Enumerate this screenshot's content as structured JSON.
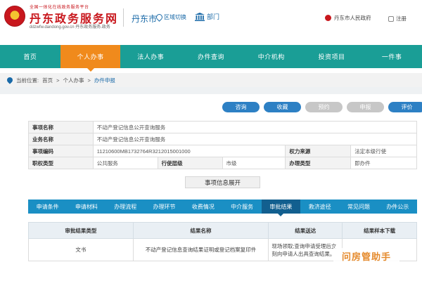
{
  "header": {
    "logo_subtitle": "全国一体化在线政务服务平台",
    "logo_title": "丹东政务服务网",
    "logo_domain": "ddzwfw.dandong.gov.cn 丹东政务服务.政务",
    "city": "丹东市",
    "region_switch": "区域切换",
    "department": "部门",
    "gov_link": "丹东市人民政府",
    "login": "注册"
  },
  "nav": {
    "items": [
      {
        "label": "首页",
        "active": false
      },
      {
        "label": "个人办事",
        "active": true
      },
      {
        "label": "法人办事",
        "active": false
      },
      {
        "label": "办件查询",
        "active": false
      },
      {
        "label": "中介机构",
        "active": false
      },
      {
        "label": "投资项目",
        "active": false
      },
      {
        "label": "一件事",
        "active": false
      }
    ]
  },
  "breadcrumb": {
    "prefix": "当前位置:",
    "items": [
      "首页",
      "个人办事",
      "办件申报"
    ],
    "separator": ">"
  },
  "actions": [
    {
      "label": "咨询",
      "enabled": true
    },
    {
      "label": "收藏",
      "enabled": true
    },
    {
      "label": "预约",
      "enabled": false
    },
    {
      "label": "申报",
      "enabled": false
    },
    {
      "label": "评价",
      "enabled": true
    }
  ],
  "info": {
    "item_name_label": "事项名称",
    "item_name_value": "不动产登记信息公开查询服务",
    "business_name_label": "业务名称",
    "business_name_value": "不动产登记信息公开查询服务",
    "item_code_label": "事项编码",
    "item_code_value": "11210600MB1732764R3212015001000",
    "power_source_label": "权力来源",
    "power_source_value": "法定本级行使",
    "duty_type_label": "职权类型",
    "duty_type_value": "公共服务",
    "level_label": "行使层级",
    "level_value": "市级",
    "handle_type_label": "办理类型",
    "handle_type_value": "即办件"
  },
  "expand_label": "事项信息展开",
  "tabs": [
    {
      "label": "申请条件",
      "active": false
    },
    {
      "label": "申请材料",
      "active": false
    },
    {
      "label": "办理流程",
      "active": false
    },
    {
      "label": "办理环节",
      "active": false
    },
    {
      "label": "收费情况",
      "active": false
    },
    {
      "label": "中介服务",
      "active": false
    },
    {
      "label": "审批结果",
      "active": true
    },
    {
      "label": "救济途径",
      "active": false
    },
    {
      "label": "常见问题",
      "active": false
    },
    {
      "label": "办件公示",
      "active": false
    }
  ],
  "results": {
    "headers": [
      "审批结果类型",
      "结果名称",
      "结果送达",
      "结果样本下载"
    ],
    "row": {
      "type": "文书",
      "name": "不动产登记信息查询结果证明或登记档案复印件",
      "delivery_line1": "现场领取;查询申请受理后立",
      "delivery_line2": "刻向申请人出具查询结果。",
      "sample": ""
    }
  },
  "watermark": "问房管助手",
  "colors": {
    "nav_bg": "#1a9e96",
    "nav_active": "#f08a1c",
    "brand_red": "#c8171d",
    "tab_bg": "#1a8fc4",
    "button_blue": "#2d80c4"
  }
}
